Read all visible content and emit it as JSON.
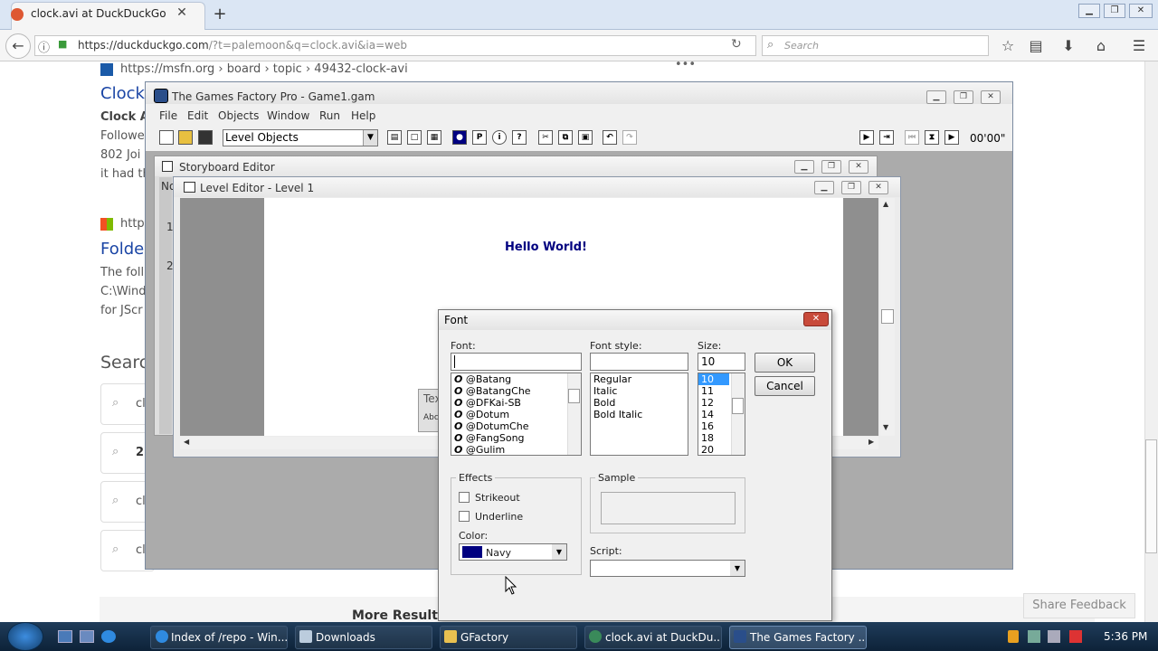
{
  "browser": {
    "tab_title": "clock.avi at DuckDuckGo",
    "tab_close": "✕",
    "new_tab": "+",
    "url_domain": "https://duckduckgo.com",
    "url_path": "/?t=palemoon&q=clock.avi&ia=web",
    "search_placeholder": "Search",
    "win_min": "▁",
    "win_max": "❐",
    "win_close": "✕",
    "back": "←",
    "info_icon": "ⓘ",
    "reload": "↻"
  },
  "page": {
    "result1_breadcrumb": "https://msfn.org › board › topic › 49432-clock-avi",
    "result1_title": "Clock",
    "result1_snip1": "Clock A",
    "result1_snip2": "Followe",
    "result1_snip3": "802 Joi",
    "result1_snip4": "it had th",
    "result1_menu": "•••",
    "result2_breadcrumb": "http",
    "result2_title": "Folde",
    "result2_snip1": "The foll",
    "result2_snip2": "C:\\Wind",
    "result2_snip3": "for JScr",
    "searches_heading": "Searc",
    "related": [
      "cl",
      "2",
      "cl",
      "cl"
    ],
    "more_results": "More Results",
    "share_feedback": "Share Feedback"
  },
  "gamesfactory": {
    "title": "The Games Factory Pro - Game1.gam",
    "menus": [
      "File",
      "Edit",
      "Objects",
      "Window",
      "Run",
      "Help"
    ],
    "level_select": "Level Objects",
    "timer": "00'00\"",
    "storyboard_title": "Storyboard Editor",
    "storyboard_col": "No",
    "storyboard_rows": [
      "1",
      "2"
    ],
    "level_editor_title": "Level Editor - Level 1",
    "hello_text": "Hello World!",
    "text_obj_label": "Tex",
    "text_obj_sub": "Abc"
  },
  "font_dialog": {
    "title": "Font",
    "font_label": "Font:",
    "font_value": "",
    "fonts": [
      "@Batang",
      "@BatangChe",
      "@DFKai-SB",
      "@Dotum",
      "@DotumChe",
      "@FangSong",
      "@Gulim"
    ],
    "style_label": "Font style:",
    "style_value": "",
    "styles": [
      "Regular",
      "Italic",
      "Bold",
      "Bold Italic"
    ],
    "size_label": "Size:",
    "size_value": "10",
    "sizes": [
      "10",
      "11",
      "12",
      "14",
      "16",
      "18",
      "20"
    ],
    "ok": "OK",
    "cancel": "Cancel",
    "effects_label": "Effects",
    "strikeout": "Strikeout",
    "underline": "Underline",
    "color_label": "Color:",
    "color_value": "Navy",
    "color_swatch": "#000080",
    "sample_label": "Sample",
    "script_label": "Script:",
    "script_value": ""
  },
  "taskbar": {
    "items": [
      {
        "label": "Index of /repo - Win..."
      },
      {
        "label": "Downloads"
      },
      {
        "label": "GFactory"
      },
      {
        "label": "clock.avi at DuckDu..."
      },
      {
        "label": "The Games Factory ..."
      }
    ],
    "clock": "5:36 PM"
  }
}
